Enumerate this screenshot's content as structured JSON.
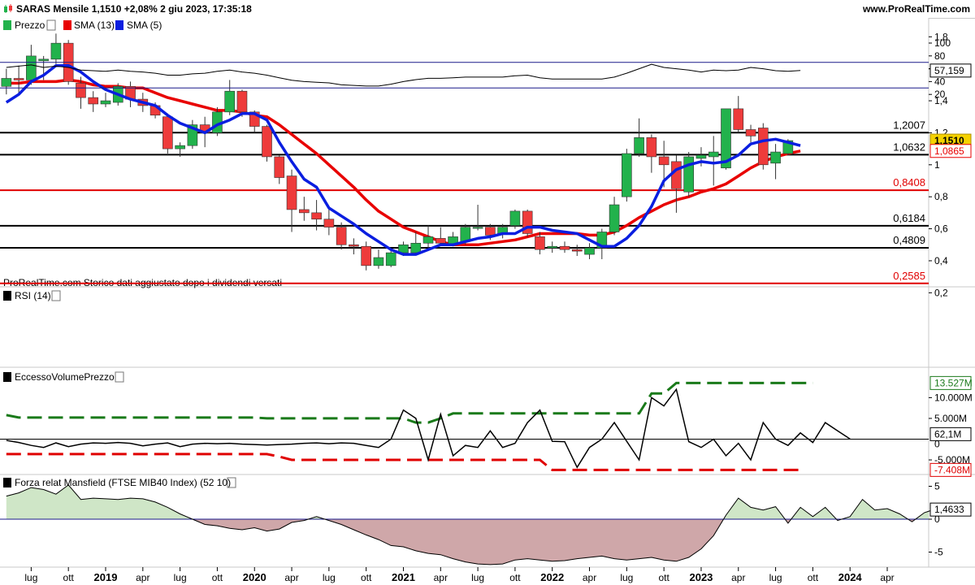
{
  "header": {
    "title": "SARAS Mensile 1,1510 +2,08% 2 giu 2023, 17:35:18",
    "site": "www.ProRealTime.com"
  },
  "price_panel": {
    "legend": [
      "Prezzo",
      "SMA (13)",
      "SMA (5)"
    ],
    "footer_note": "ProRealTime.com Storico dati aggiustato dopo i dividendi versati",
    "y_ticks": [
      "1,8",
      "1,6",
      "1,4",
      "1,2",
      "1",
      "0,8",
      "0,6",
      "0,4",
      "0,2"
    ],
    "levels": [
      {
        "label": "1,2007",
        "value": 1.2007,
        "color": "#000000"
      },
      {
        "label": "1,0632",
        "value": 1.0632,
        "color": "#000000"
      },
      {
        "label": "0,8408",
        "value": 0.8408,
        "color": "#e00000"
      },
      {
        "label": "0,6184",
        "value": 0.6184,
        "color": "#000000"
      },
      {
        "label": "0,4809",
        "value": 0.4809,
        "color": "#000000"
      },
      {
        "label": "0,2585",
        "value": 0.2585,
        "color": "#e00000"
      }
    ],
    "price_badge": "1,1510",
    "sma13_badge": "1,0865"
  },
  "rsi_panel": {
    "legend": "RSI (14)",
    "y_ticks": [
      "100",
      "80",
      "60",
      "40",
      "20"
    ],
    "badge": "57,159"
  },
  "volume_panel": {
    "legend": "EccessoVolumePrezzo",
    "y_ticks": [
      "10.000M",
      "5.000M",
      "-5.000M"
    ],
    "badge_top": "13.527M",
    "badge_mid": "62,1M",
    "badge_zero": "0",
    "badge_bottom": "-7.408M"
  },
  "mansfield_panel": {
    "legend": "Forza relat Mansfield (FTSE MIB40 Index) (52 10)",
    "y_ticks": [
      "5",
      "0",
      "-5"
    ],
    "badge": "1,4633"
  },
  "x_axis": {
    "labels": [
      "lug",
      "ott",
      "2019",
      "apr",
      "lug",
      "ott",
      "2020",
      "apr",
      "lug",
      "ott",
      "2021",
      "apr",
      "lug",
      "ott",
      "2022",
      "apr",
      "lug",
      "ott",
      "2023",
      "apr",
      "lug",
      "ott",
      "2024",
      "apr"
    ]
  },
  "colors": {
    "up": "#22b24c",
    "down": "#ee3b3b",
    "sma13": "#e80000",
    "sma5": "#0a1ee0",
    "vol_upper": "#1a7a1a",
    "vol_lower": "#e00000"
  },
  "chart_data": {
    "type": "candlestick",
    "timeframe": "monthly",
    "candles": [
      {
        "t": "2018-05",
        "o": 1.49,
        "h": 1.6,
        "l": 1.44,
        "c": 1.54
      },
      {
        "t": "2018-06",
        "o": 1.54,
        "h": 1.62,
        "l": 1.45,
        "c": 1.53
      },
      {
        "t": "2018-07",
        "o": 1.53,
        "h": 1.75,
        "l": 1.5,
        "c": 1.68
      },
      {
        "t": "2018-08",
        "o": 1.65,
        "h": 1.68,
        "l": 1.53,
        "c": 1.66
      },
      {
        "t": "2018-09",
        "o": 1.66,
        "h": 1.82,
        "l": 1.63,
        "c": 1.76
      },
      {
        "t": "2018-10",
        "o": 1.76,
        "h": 1.78,
        "l": 1.5,
        "c": 1.52
      },
      {
        "t": "2018-11",
        "o": 1.51,
        "h": 1.55,
        "l": 1.35,
        "c": 1.42
      },
      {
        "t": "2018-12",
        "o": 1.42,
        "h": 1.46,
        "l": 1.33,
        "c": 1.38
      },
      {
        "t": "2019-01",
        "o": 1.38,
        "h": 1.45,
        "l": 1.36,
        "c": 1.4
      },
      {
        "t": "2019-02",
        "o": 1.39,
        "h": 1.51,
        "l": 1.37,
        "c": 1.49
      },
      {
        "t": "2019-03",
        "o": 1.49,
        "h": 1.52,
        "l": 1.36,
        "c": 1.41
      },
      {
        "t": "2019-04",
        "o": 1.41,
        "h": 1.45,
        "l": 1.33,
        "c": 1.37
      },
      {
        "t": "2019-05",
        "o": 1.37,
        "h": 1.39,
        "l": 1.29,
        "c": 1.31
      },
      {
        "t": "2019-06",
        "o": 1.3,
        "h": 1.32,
        "l": 1.07,
        "c": 1.1
      },
      {
        "t": "2019-07",
        "o": 1.1,
        "h": 1.14,
        "l": 1.05,
        "c": 1.12
      },
      {
        "t": "2019-08",
        "o": 1.12,
        "h": 1.28,
        "l": 1.1,
        "c": 1.25
      },
      {
        "t": "2019-09",
        "o": 1.25,
        "h": 1.3,
        "l": 1.11,
        "c": 1.2
      },
      {
        "t": "2019-10",
        "o": 1.2,
        "h": 1.36,
        "l": 1.18,
        "c": 1.33
      },
      {
        "t": "2019-11",
        "o": 1.33,
        "h": 1.53,
        "l": 1.31,
        "c": 1.46
      },
      {
        "t": "2019-12",
        "o": 1.46,
        "h": 1.47,
        "l": 1.3,
        "c": 1.33
      },
      {
        "t": "2020-01",
        "o": 1.33,
        "h": 1.34,
        "l": 1.2,
        "c": 1.24
      },
      {
        "t": "2020-02",
        "o": 1.24,
        "h": 1.25,
        "l": 1.02,
        "c": 1.05
      },
      {
        "t": "2020-03",
        "o": 1.05,
        "h": 1.06,
        "l": 0.88,
        "c": 0.92
      },
      {
        "t": "2020-04",
        "o": 0.93,
        "h": 0.97,
        "l": 0.58,
        "c": 0.72
      },
      {
        "t": "2020-05",
        "o": 0.72,
        "h": 0.8,
        "l": 0.65,
        "c": 0.7
      },
      {
        "t": "2020-06",
        "o": 0.7,
        "h": 0.78,
        "l": 0.59,
        "c": 0.66
      },
      {
        "t": "2020-07",
        "o": 0.66,
        "h": 0.73,
        "l": 0.56,
        "c": 0.61
      },
      {
        "t": "2020-08",
        "o": 0.61,
        "h": 0.64,
        "l": 0.47,
        "c": 0.5
      },
      {
        "t": "2020-09",
        "o": 0.5,
        "h": 0.54,
        "l": 0.44,
        "c": 0.49
      },
      {
        "t": "2020-10",
        "o": 0.49,
        "h": 0.52,
        "l": 0.34,
        "c": 0.37
      },
      {
        "t": "2020-11",
        "o": 0.37,
        "h": 0.47,
        "l": 0.35,
        "c": 0.42
      },
      {
        "t": "2020-12",
        "o": 0.37,
        "h": 0.47,
        "l": 0.36,
        "c": 0.45
      },
      {
        "t": "2021-01",
        "o": 0.45,
        "h": 0.52,
        "l": 0.43,
        "c": 0.5
      },
      {
        "t": "2021-02",
        "o": 0.45,
        "h": 0.58,
        "l": 0.44,
        "c": 0.51
      },
      {
        "t": "2021-03",
        "o": 0.51,
        "h": 0.62,
        "l": 0.48,
        "c": 0.55
      },
      {
        "t": "2021-04",
        "o": 0.54,
        "h": 0.61,
        "l": 0.5,
        "c": 0.51
      },
      {
        "t": "2021-05",
        "o": 0.5,
        "h": 0.58,
        "l": 0.49,
        "c": 0.55
      },
      {
        "t": "2021-06",
        "o": 0.52,
        "h": 0.63,
        "l": 0.5,
        "c": 0.61
      },
      {
        "t": "2021-07",
        "o": 0.61,
        "h": 0.75,
        "l": 0.59,
        "c": 0.61
      },
      {
        "t": "2021-08",
        "o": 0.61,
        "h": 0.63,
        "l": 0.53,
        "c": 0.56
      },
      {
        "t": "2021-09",
        "o": 0.57,
        "h": 0.63,
        "l": 0.54,
        "c": 0.61
      },
      {
        "t": "2021-10",
        "o": 0.62,
        "h": 0.72,
        "l": 0.6,
        "c": 0.71
      },
      {
        "t": "2021-11",
        "o": 0.71,
        "h": 0.72,
        "l": 0.55,
        "c": 0.57
      },
      {
        "t": "2021-12",
        "o": 0.55,
        "h": 0.58,
        "l": 0.44,
        "c": 0.47
      },
      {
        "t": "2022-01",
        "o": 0.48,
        "h": 0.52,
        "l": 0.45,
        "c": 0.49
      },
      {
        "t": "2022-02",
        "o": 0.49,
        "h": 0.52,
        "l": 0.45,
        "c": 0.47
      },
      {
        "t": "2022-03",
        "o": 0.47,
        "h": 0.5,
        "l": 0.43,
        "c": 0.46
      },
      {
        "t": "2022-04",
        "o": 0.44,
        "h": 0.51,
        "l": 0.41,
        "c": 0.48
      },
      {
        "t": "2022-05",
        "o": 0.48,
        "h": 0.6,
        "l": 0.41,
        "c": 0.58
      },
      {
        "t": "2022-06",
        "o": 0.58,
        "h": 0.8,
        "l": 0.56,
        "c": 0.75
      },
      {
        "t": "2022-07",
        "o": 0.8,
        "h": 1.1,
        "l": 0.77,
        "c": 1.07
      },
      {
        "t": "2022-08",
        "o": 1.07,
        "h": 1.29,
        "l": 1.05,
        "c": 1.17
      },
      {
        "t": "2022-09",
        "o": 1.17,
        "h": 1.19,
        "l": 0.95,
        "c": 1.05
      },
      {
        "t": "2022-10",
        "o": 1.05,
        "h": 1.15,
        "l": 0.86,
        "c": 1.0
      },
      {
        "t": "2022-11",
        "o": 1.02,
        "h": 1.06,
        "l": 0.7,
        "c": 0.85
      },
      {
        "t": "2022-12",
        "o": 0.83,
        "h": 1.08,
        "l": 0.8,
        "c": 1.05
      },
      {
        "t": "2023-01",
        "o": 1.04,
        "h": 1.11,
        "l": 0.99,
        "c": 1.06
      },
      {
        "t": "2023-02",
        "o": 1.05,
        "h": 1.18,
        "l": 0.87,
        "c": 1.08
      },
      {
        "t": "2023-03",
        "o": 0.98,
        "h": 1.33,
        "l": 0.97,
        "c": 1.35
      },
      {
        "t": "2023-04",
        "o": 1.35,
        "h": 1.43,
        "l": 1.2,
        "c": 1.22
      },
      {
        "t": "2023-05",
        "o": 1.22,
        "h": 1.25,
        "l": 1.14,
        "c": 1.18
      },
      {
        "t": "2023-06",
        "o": 1.23,
        "h": 1.26,
        "l": 0.97,
        "c": 1.0
      },
      {
        "t": "2023-07",
        "o": 1.01,
        "h": 1.13,
        "l": 0.91,
        "c": 1.08
      },
      {
        "t": "2023-08",
        "o": 1.07,
        "h": 1.16,
        "l": 1.06,
        "c": 1.151
      }
    ],
    "sma5": [
      1.39,
      1.44,
      1.52,
      1.56,
      1.62,
      1.62,
      1.58,
      1.52,
      1.47,
      1.44,
      1.41,
      1.39,
      1.37,
      1.31,
      1.26,
      1.23,
      1.2,
      1.25,
      1.28,
      1.32,
      1.32,
      1.28,
      1.14,
      1.02,
      0.91,
      0.86,
      0.73,
      0.68,
      0.63,
      0.57,
      0.52,
      0.47,
      0.44,
      0.44,
      0.47,
      0.5,
      0.5,
      0.52,
      0.54,
      0.55,
      0.57,
      0.57,
      0.61,
      0.61,
      0.59,
      0.58,
      0.57,
      0.53,
      0.49,
      0.49,
      0.54,
      0.62,
      0.74,
      0.9,
      0.97,
      1.0,
      1.02,
      1.01,
      1.02,
      1.06,
      1.13,
      1.15,
      1.16,
      1.14,
      1.12
    ],
    "sma13": [
      1.51,
      1.51,
      1.52,
      1.52,
      1.52,
      1.53,
      1.52,
      1.5,
      1.49,
      1.49,
      1.48,
      1.48,
      1.45,
      1.42,
      1.4,
      1.38,
      1.36,
      1.34,
      1.34,
      1.33,
      1.31,
      1.3,
      1.25,
      1.19,
      1.13,
      1.07,
      1.0,
      0.93,
      0.86,
      0.78,
      0.71,
      0.66,
      0.61,
      0.58,
      0.55,
      0.52,
      0.5,
      0.5,
      0.5,
      0.51,
      0.52,
      0.53,
      0.55,
      0.57,
      0.57,
      0.57,
      0.57,
      0.56,
      0.56,
      0.58,
      0.62,
      0.67,
      0.71,
      0.75,
      0.78,
      0.8,
      0.83,
      0.85,
      0.88,
      0.93,
      0.98,
      1.02,
      1.05,
      1.07,
      1.0865
    ],
    "rsi": [
      62,
      64,
      66,
      62,
      64,
      62,
      58,
      57,
      56,
      58,
      56,
      55,
      53,
      50,
      50,
      52,
      53,
      56,
      58,
      55,
      53,
      50,
      46,
      42,
      40,
      39,
      38,
      35,
      34,
      33,
      33,
      36,
      40,
      43,
      45,
      45,
      46,
      47,
      47,
      47,
      47,
      49,
      50,
      46,
      44,
      44,
      44,
      44,
      44,
      47,
      53,
      60,
      67,
      62,
      60,
      58,
      55,
      58,
      57,
      58,
      62,
      60,
      57,
      56,
      57.159
    ],
    "volume_excess": [
      -300,
      -800,
      -1500,
      -2000,
      -900,
      -1800,
      -1200,
      -900,
      -1000,
      -800,
      -1000,
      -1600,
      -1200,
      -900,
      -1800,
      -1200,
      -1000,
      -1100,
      -1000,
      -1200,
      -1300,
      -1400,
      -1300,
      -1200,
      -1000,
      -900,
      -1100,
      -900,
      -1000,
      -1500,
      -2000,
      0,
      7000,
      5000,
      -5000,
      6000,
      -4000,
      -1500,
      -2000,
      2000,
      -2000,
      -1000,
      4000,
      7000,
      -500,
      -600,
      -6800,
      -2000,
      0,
      4000,
      -500,
      -5000,
      10000,
      8000,
      12000,
      -600,
      -2000,
      0,
      -4000,
      -1000,
      -5000,
      4000,
      0,
      -1500,
      1500,
      -800,
      4000,
      2000,
      62.1
    ],
    "volume_upper_band": [
      5800,
      5200,
      5200,
      5200,
      5200,
      5200,
      5200,
      5200,
      5200,
      5200,
      5200,
      5200,
      5200,
      5200,
      5200,
      5200,
      5200,
      5200,
      5200,
      5200,
      5200,
      5000,
      5000,
      5000,
      5000,
      5000,
      5000,
      5000,
      5000,
      5000,
      5000,
      5000,
      5000,
      4000,
      4000,
      5000,
      6200,
      6200,
      6200,
      6200,
      6200,
      6200,
      6200,
      6200,
      6200,
      6200,
      6200,
      6200,
      6200,
      6200,
      6200,
      6200,
      11000,
      11000,
      13527,
      13527,
      13527,
      13527,
      13527,
      13527,
      13527,
      13527,
      13527,
      13527,
      13527,
      13527
    ],
    "volume_lower_band": [
      -3600,
      -3600,
      -3600,
      -3600,
      -3600,
      -3600,
      -3600,
      -3600,
      -3600,
      -3600,
      -3600,
      -3600,
      -3600,
      -3600,
      -3600,
      -3600,
      -3600,
      -3600,
      -3600,
      -3600,
      -3600,
      -3600,
      -4200,
      -5000,
      -5000,
      -5000,
      -5000,
      -5000,
      -5000,
      -5000,
      -5000,
      -5000,
      -5000,
      -5000,
      -5000,
      -5000,
      -5000,
      -5000,
      -5000,
      -5000,
      -5000,
      -5000,
      -5000,
      -5000,
      -7408,
      -7408,
      -7408,
      -7408,
      -7408,
      -7408,
      -7408,
      -7408,
      -7408,
      -7408,
      -7408,
      -7408,
      -7408,
      -7408,
      -7408,
      -7408,
      -7408,
      -7408,
      -7408,
      -7408,
      -7408
    ],
    "mansfield": [
      3.5,
      4.0,
      4.8,
      4.5,
      3.8,
      5.2,
      3.0,
      3.2,
      3.1,
      3.0,
      3.2,
      3.1,
      2.6,
      1.8,
      0.8,
      0.0,
      -0.8,
      -1.0,
      -1.4,
      -1.6,
      -1.3,
      -1.8,
      -1.5,
      -0.5,
      -0.2,
      0.4,
      -0.2,
      -0.8,
      -1.6,
      -2.4,
      -3.1,
      -4.0,
      -4.2,
      -4.8,
      -5.2,
      -5.4,
      -6.0,
      -6.5,
      -6.8,
      -6.9,
      -6.8,
      -6.2,
      -6.0,
      -6.2,
      -6.4,
      -6.3,
      -6.0,
      -5.8,
      -5.6,
      -6.0,
      -6.2,
      -6.0,
      -5.8,
      -6.2,
      -6.4,
      -5.8,
      -4.5,
      -2.5,
      0.6,
      3.2,
      1.8,
      1.4,
      1.9,
      -0.6,
      1.8,
      0.4,
      1.8,
      -0.2,
      0.4,
      3.0,
      1.4,
      1.6,
      0.8,
      -0.4,
      1.0,
      1.6,
      1.4633
    ]
  }
}
